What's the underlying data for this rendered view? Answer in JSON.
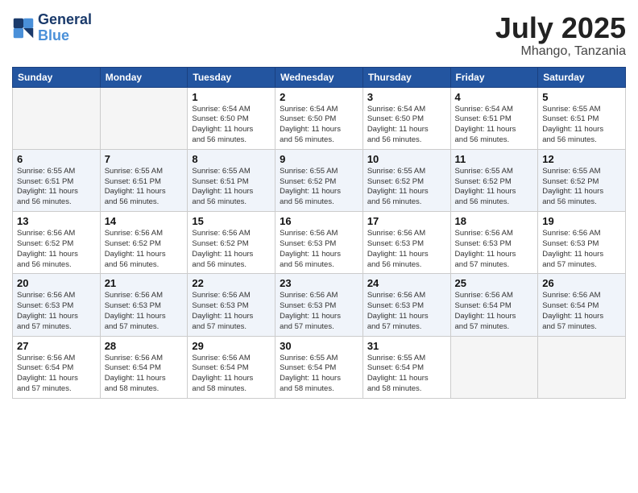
{
  "logo": {
    "line1": "General",
    "line2": "Blue"
  },
  "title": "July 2025",
  "location": "Mhango, Tanzania",
  "weekdays": [
    "Sunday",
    "Monday",
    "Tuesday",
    "Wednesday",
    "Thursday",
    "Friday",
    "Saturday"
  ],
  "weeks": [
    [
      {
        "day": "",
        "info": ""
      },
      {
        "day": "",
        "info": ""
      },
      {
        "day": "1",
        "info": "Sunrise: 6:54 AM\nSunset: 6:50 PM\nDaylight: 11 hours\nand 56 minutes."
      },
      {
        "day": "2",
        "info": "Sunrise: 6:54 AM\nSunset: 6:50 PM\nDaylight: 11 hours\nand 56 minutes."
      },
      {
        "day": "3",
        "info": "Sunrise: 6:54 AM\nSunset: 6:50 PM\nDaylight: 11 hours\nand 56 minutes."
      },
      {
        "day": "4",
        "info": "Sunrise: 6:54 AM\nSunset: 6:51 PM\nDaylight: 11 hours\nand 56 minutes."
      },
      {
        "day": "5",
        "info": "Sunrise: 6:55 AM\nSunset: 6:51 PM\nDaylight: 11 hours\nand 56 minutes."
      }
    ],
    [
      {
        "day": "6",
        "info": "Sunrise: 6:55 AM\nSunset: 6:51 PM\nDaylight: 11 hours\nand 56 minutes."
      },
      {
        "day": "7",
        "info": "Sunrise: 6:55 AM\nSunset: 6:51 PM\nDaylight: 11 hours\nand 56 minutes."
      },
      {
        "day": "8",
        "info": "Sunrise: 6:55 AM\nSunset: 6:51 PM\nDaylight: 11 hours\nand 56 minutes."
      },
      {
        "day": "9",
        "info": "Sunrise: 6:55 AM\nSunset: 6:52 PM\nDaylight: 11 hours\nand 56 minutes."
      },
      {
        "day": "10",
        "info": "Sunrise: 6:55 AM\nSunset: 6:52 PM\nDaylight: 11 hours\nand 56 minutes."
      },
      {
        "day": "11",
        "info": "Sunrise: 6:55 AM\nSunset: 6:52 PM\nDaylight: 11 hours\nand 56 minutes."
      },
      {
        "day": "12",
        "info": "Sunrise: 6:55 AM\nSunset: 6:52 PM\nDaylight: 11 hours\nand 56 minutes."
      }
    ],
    [
      {
        "day": "13",
        "info": "Sunrise: 6:56 AM\nSunset: 6:52 PM\nDaylight: 11 hours\nand 56 minutes."
      },
      {
        "day": "14",
        "info": "Sunrise: 6:56 AM\nSunset: 6:52 PM\nDaylight: 11 hours\nand 56 minutes."
      },
      {
        "day": "15",
        "info": "Sunrise: 6:56 AM\nSunset: 6:52 PM\nDaylight: 11 hours\nand 56 minutes."
      },
      {
        "day": "16",
        "info": "Sunrise: 6:56 AM\nSunset: 6:53 PM\nDaylight: 11 hours\nand 56 minutes."
      },
      {
        "day": "17",
        "info": "Sunrise: 6:56 AM\nSunset: 6:53 PM\nDaylight: 11 hours\nand 56 minutes."
      },
      {
        "day": "18",
        "info": "Sunrise: 6:56 AM\nSunset: 6:53 PM\nDaylight: 11 hours\nand 57 minutes."
      },
      {
        "day": "19",
        "info": "Sunrise: 6:56 AM\nSunset: 6:53 PM\nDaylight: 11 hours\nand 57 minutes."
      }
    ],
    [
      {
        "day": "20",
        "info": "Sunrise: 6:56 AM\nSunset: 6:53 PM\nDaylight: 11 hours\nand 57 minutes."
      },
      {
        "day": "21",
        "info": "Sunrise: 6:56 AM\nSunset: 6:53 PM\nDaylight: 11 hours\nand 57 minutes."
      },
      {
        "day": "22",
        "info": "Sunrise: 6:56 AM\nSunset: 6:53 PM\nDaylight: 11 hours\nand 57 minutes."
      },
      {
        "day": "23",
        "info": "Sunrise: 6:56 AM\nSunset: 6:53 PM\nDaylight: 11 hours\nand 57 minutes."
      },
      {
        "day": "24",
        "info": "Sunrise: 6:56 AM\nSunset: 6:53 PM\nDaylight: 11 hours\nand 57 minutes."
      },
      {
        "day": "25",
        "info": "Sunrise: 6:56 AM\nSunset: 6:54 PM\nDaylight: 11 hours\nand 57 minutes."
      },
      {
        "day": "26",
        "info": "Sunrise: 6:56 AM\nSunset: 6:54 PM\nDaylight: 11 hours\nand 57 minutes."
      }
    ],
    [
      {
        "day": "27",
        "info": "Sunrise: 6:56 AM\nSunset: 6:54 PM\nDaylight: 11 hours\nand 57 minutes."
      },
      {
        "day": "28",
        "info": "Sunrise: 6:56 AM\nSunset: 6:54 PM\nDaylight: 11 hours\nand 58 minutes."
      },
      {
        "day": "29",
        "info": "Sunrise: 6:56 AM\nSunset: 6:54 PM\nDaylight: 11 hours\nand 58 minutes."
      },
      {
        "day": "30",
        "info": "Sunrise: 6:55 AM\nSunset: 6:54 PM\nDaylight: 11 hours\nand 58 minutes."
      },
      {
        "day": "31",
        "info": "Sunrise: 6:55 AM\nSunset: 6:54 PM\nDaylight: 11 hours\nand 58 minutes."
      },
      {
        "day": "",
        "info": ""
      },
      {
        "day": "",
        "info": ""
      }
    ]
  ]
}
